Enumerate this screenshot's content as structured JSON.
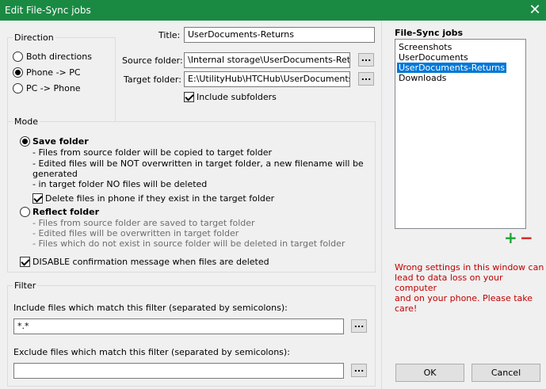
{
  "window": {
    "title": "Edit File-Sync jobs"
  },
  "direction": {
    "legend": "Direction",
    "options": [
      "Both directions",
      "Phone -> PC",
      "PC -> Phone"
    ],
    "selected_index": 1
  },
  "job": {
    "title_label": "Title:",
    "title_value": "UserDocuments-Returns",
    "source_label": "Source folder:",
    "source_value": "\\Internal storage\\UserDocuments-Returns",
    "target_label": "Target folder:",
    "target_value": "E:\\UtilityHub\\HTCHub\\UserDocuments-Returns",
    "browse_label": "...",
    "include_subfolders_label": "Include subfolders",
    "include_subfolders": true
  },
  "mode": {
    "legend": "Mode",
    "save": {
      "label": "Save folder",
      "lines": [
        "- Files from source folder will be copied to target folder",
        "- Edited files will be NOT overwritten in target folder, a new filename will be",
        "generated",
        "- in target folder NO files will be deleted"
      ],
      "delete_label": "Delete files in phone if they exist in the target folder",
      "delete_checked": true
    },
    "reflect": {
      "label": "Reflect folder",
      "lines": [
        "- Files from source folder are saved to target folder",
        "- Edited files will be overwritten in target folder",
        "- Files which do not exist in source folder will be deleted in target folder"
      ]
    },
    "selected": "save",
    "disable_confirm_label": "DISABLE confirmation message when files are deleted",
    "disable_confirm_checked": true
  },
  "filter": {
    "legend": "Filter",
    "include_label": "Include files which match this filter (separated by semicolons):",
    "include_value": "*.*",
    "exclude_label": "Exclude files which match this filter (separated by semicolons):",
    "exclude_value": "",
    "browse_label": "..."
  },
  "jobs": {
    "heading": "File-Sync jobs",
    "items": [
      "Screenshots",
      "UserDocuments",
      "UserDocuments-Returns",
      "Downloads"
    ],
    "selected_index": 2,
    "add_symbol": "+",
    "remove_symbol": "−",
    "add_color": "#1fa337",
    "remove_color": "#d42020"
  },
  "warning": {
    "lines": [
      "Wrong settings in this window can",
      "lead to data loss on your computer",
      "and on your phone. Please take",
      "care!"
    ]
  },
  "buttons": {
    "ok": "OK",
    "cancel": "Cancel"
  },
  "colors": {
    "titlebar": "#1a8a43",
    "selection": "#0078d7",
    "warning": "#c00000"
  }
}
